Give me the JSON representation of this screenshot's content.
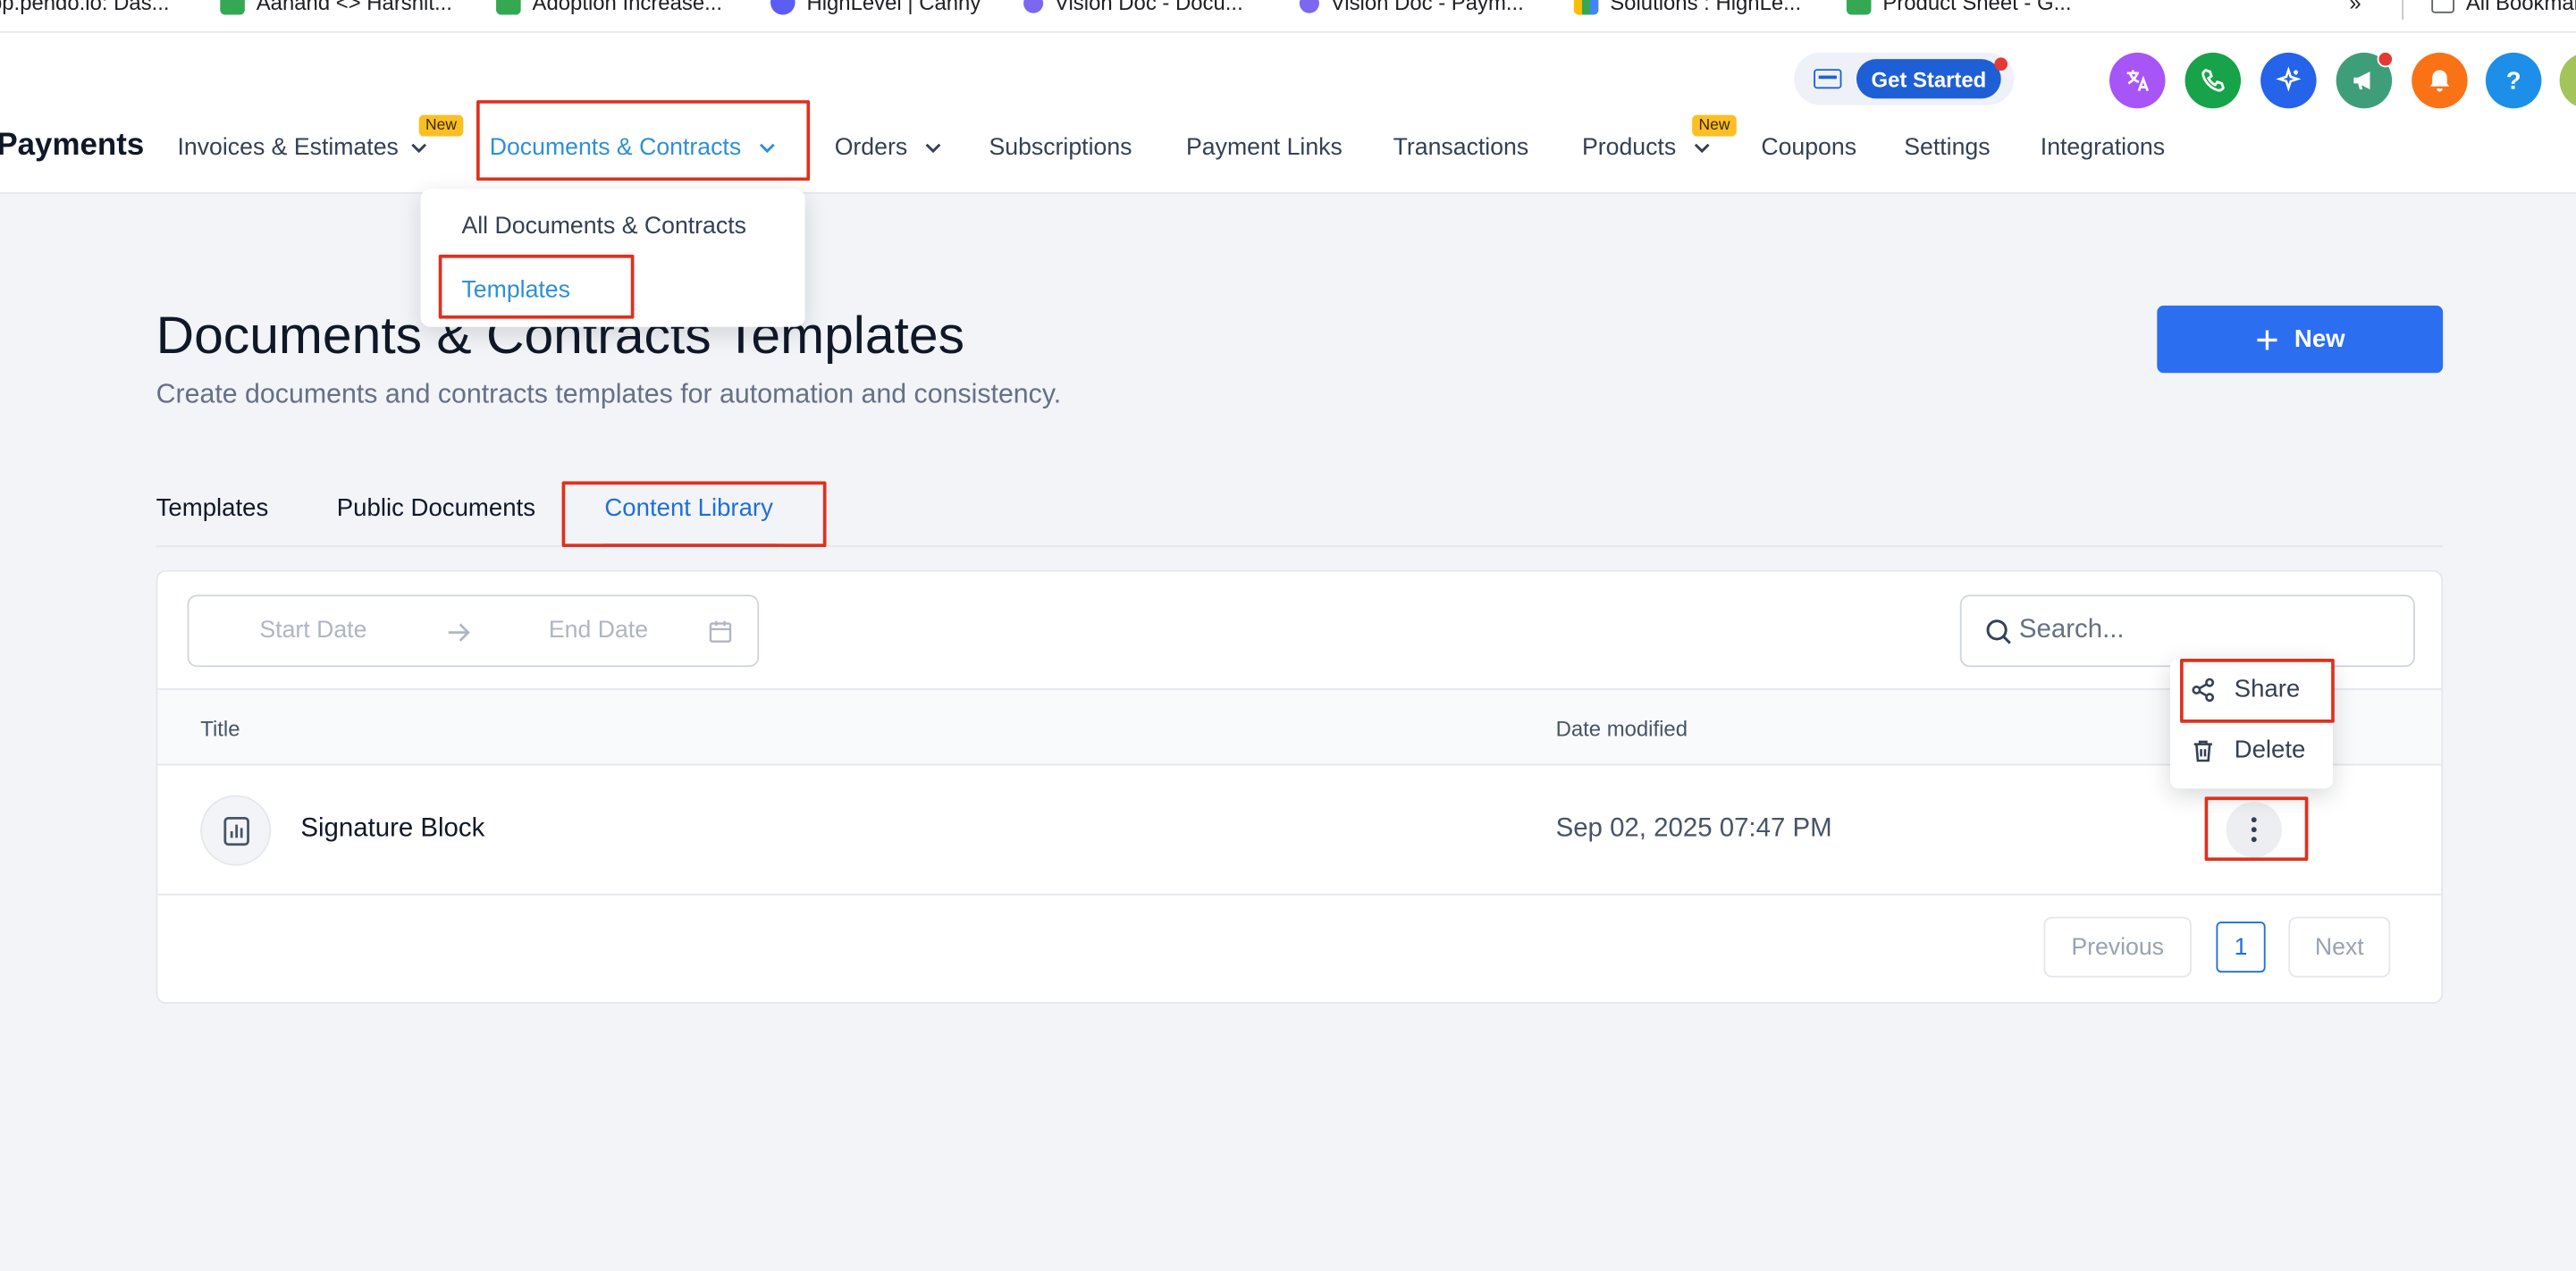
{
  "bookmarks": [
    {
      "label": "pp.pendo.io: Das...",
      "icon": "clickup-icon"
    },
    {
      "label": "Aanand <> Harshit...",
      "icon": "sheets-icon"
    },
    {
      "label": "Adoption Increase...",
      "icon": "sheets-icon"
    },
    {
      "label": "HighLevel | Canny",
      "icon": "canny-icon"
    },
    {
      "label": "Vision Doc - Docu...",
      "icon": "clickup-icon"
    },
    {
      "label": "Vision Doc - Paym...",
      "icon": "clickup-icon"
    },
    {
      "label": "Solutions : HighLe...",
      "icon": "bars-icon"
    },
    {
      "label": "Product Sheet - G...",
      "icon": "sheets-icon"
    }
  ],
  "bookmarks_more": "»",
  "bookmarks_all": "All Bookmarks",
  "header": {
    "get_started": "Get Started",
    "help_label": "?",
    "brand": "Payments",
    "nav": [
      {
        "label": "Invoices & Estimates",
        "has_chevron": true,
        "badge": "New"
      },
      {
        "label": "Documents & Contracts",
        "has_chevron": true,
        "active": true
      },
      {
        "label": "Orders",
        "has_chevron": true
      },
      {
        "label": "Subscriptions"
      },
      {
        "label": "Payment Links"
      },
      {
        "label": "Transactions"
      },
      {
        "label": "Products",
        "has_chevron": true,
        "badge": "New"
      },
      {
        "label": "Coupons"
      },
      {
        "label": "Settings"
      },
      {
        "label": "Integrations"
      }
    ],
    "avatar_colors": [
      "#a855f7",
      "#16a34a",
      "#2563eb",
      "#3f9e7a",
      "#f97316",
      "#1d8fe8",
      "#a3c45a"
    ]
  },
  "dropdown": {
    "items": [
      {
        "label": "All Documents & Contracts"
      },
      {
        "label": "Templates",
        "active": true
      }
    ]
  },
  "page": {
    "title": "Documents & Contracts Templates",
    "subtitle": "Create documents and contracts templates for automation and consistency.",
    "new_button": "New"
  },
  "tabs": [
    {
      "label": "Templates"
    },
    {
      "label": "Public Documents"
    },
    {
      "label": "Content Library",
      "active": true
    }
  ],
  "filters": {
    "start_date": "Start Date",
    "end_date": "End Date",
    "search_placeholder": "Search..."
  },
  "table": {
    "columns": [
      "Title",
      "Date modified"
    ],
    "rows": [
      {
        "title": "Signature Block",
        "date_modified": "Sep 02, 2025 07:47 PM"
      }
    ]
  },
  "pagination": {
    "previous": "Previous",
    "current_page": "1",
    "next": "Next"
  },
  "row_actions": {
    "share": "Share",
    "delete": "Delete"
  },
  "colors": {
    "primary": "#2b6ef0",
    "active_nav": "#2e8fd6",
    "highlight": "#e0301e"
  }
}
